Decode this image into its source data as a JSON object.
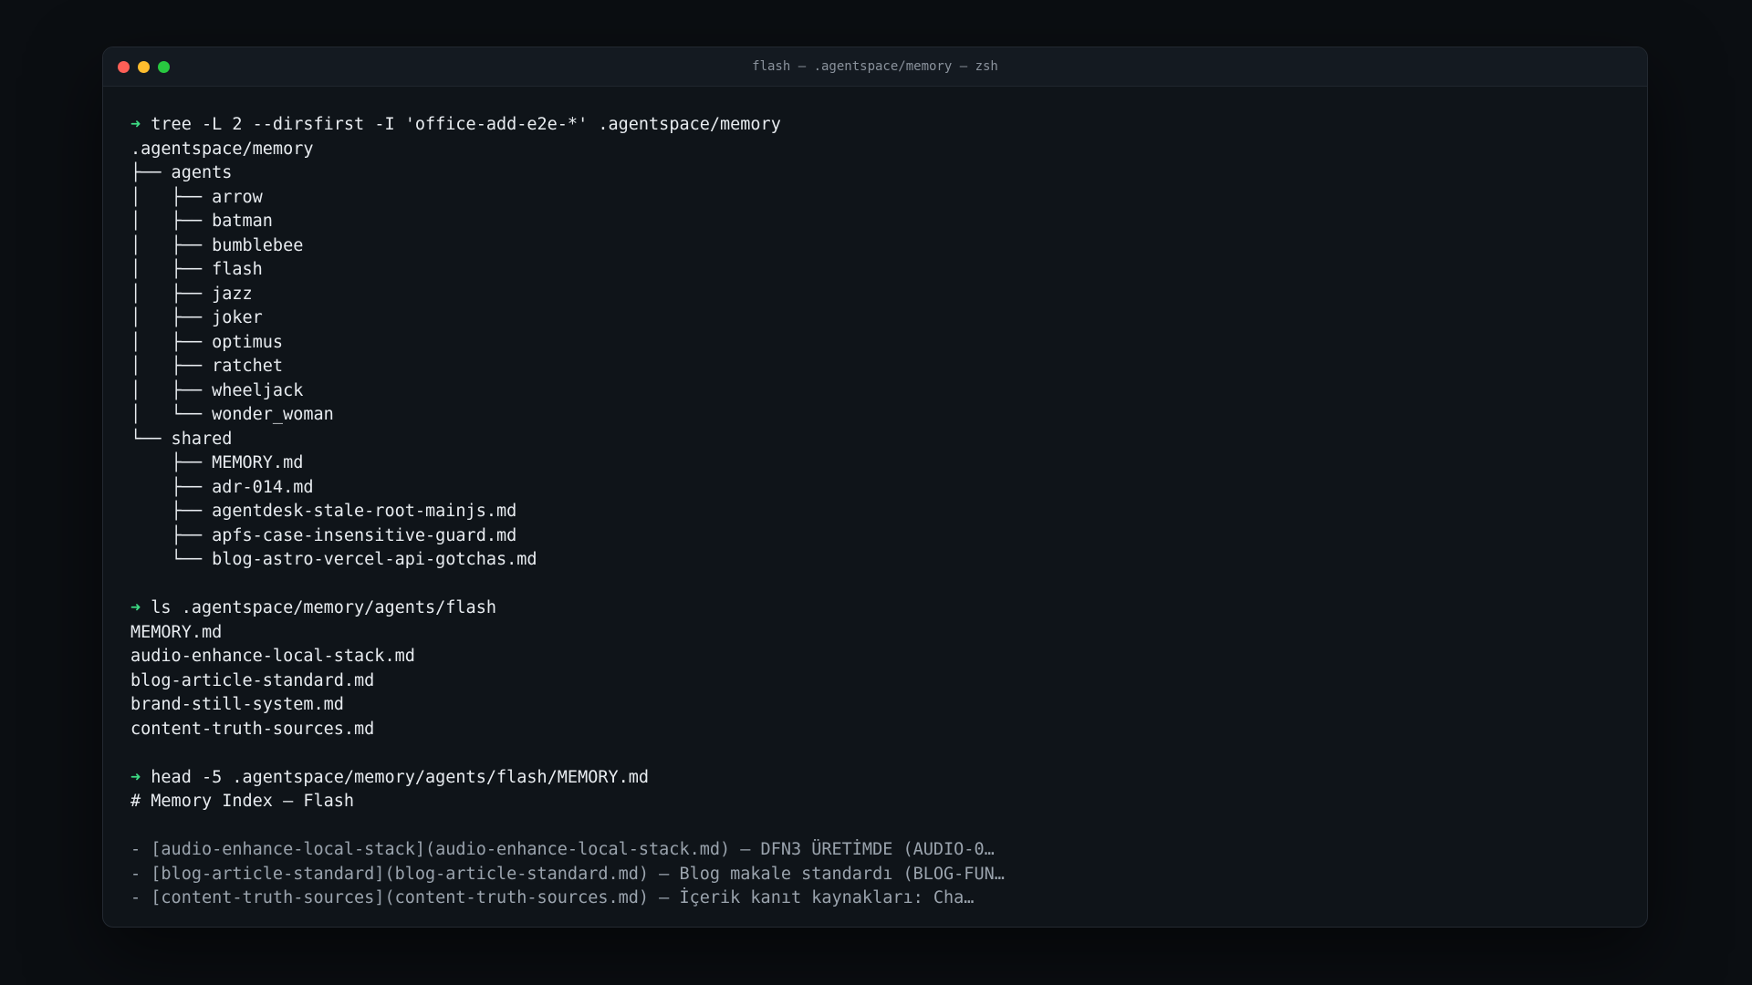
{
  "window": {
    "title": "flash — .agentspace/memory — zsh",
    "accent_colors": {
      "close": "#fe5f57",
      "minimize": "#febc2e",
      "maximize": "#28c840",
      "prompt": "#3ddc84"
    }
  },
  "prompt_symbol": "➜",
  "commands": [
    {
      "command": "tree -L 2 --dirsfirst -I 'office-add-e2e-*' .agentspace/memory",
      "output": [
        ".agentspace/memory",
        "├── agents",
        "│   ├── arrow",
        "│   ├── batman",
        "│   ├── bumblebee",
        "│   ├── flash",
        "│   ├── jazz",
        "│   ├── joker",
        "│   ├── optimus",
        "│   ├── ratchet",
        "│   ├── wheeljack",
        "│   └── wonder_woman",
        "└── shared",
        "    ├── MEMORY.md",
        "    ├── adr-014.md",
        "    ├── agentdesk-stale-root-mainjs.md",
        "    ├── apfs-case-insensitive-guard.md",
        "    └── blog-astro-vercel-api-gotchas.md"
      ]
    },
    {
      "command": "ls .agentspace/memory/agents/flash",
      "output": [
        "MEMORY.md",
        "audio-enhance-local-stack.md",
        "blog-article-standard.md",
        "brand-still-system.md",
        "content-truth-sources.md"
      ]
    },
    {
      "command": "head -5 .agentspace/memory/agents/flash/MEMORY.md",
      "output": [
        "# Memory Index — Flash",
        "",
        "- [audio-enhance-local-stack](audio-enhance-local-stack.md) — DFN3 ÜRETİMDE (AUDIO-0…",
        "- [blog-article-standard](blog-article-standard.md) — Blog makale standardı (BLOG-FUN…",
        "- [content-truth-sources](content-truth-sources.md) — İçerik kanıt kaynakları: Cha…"
      ]
    }
  ]
}
